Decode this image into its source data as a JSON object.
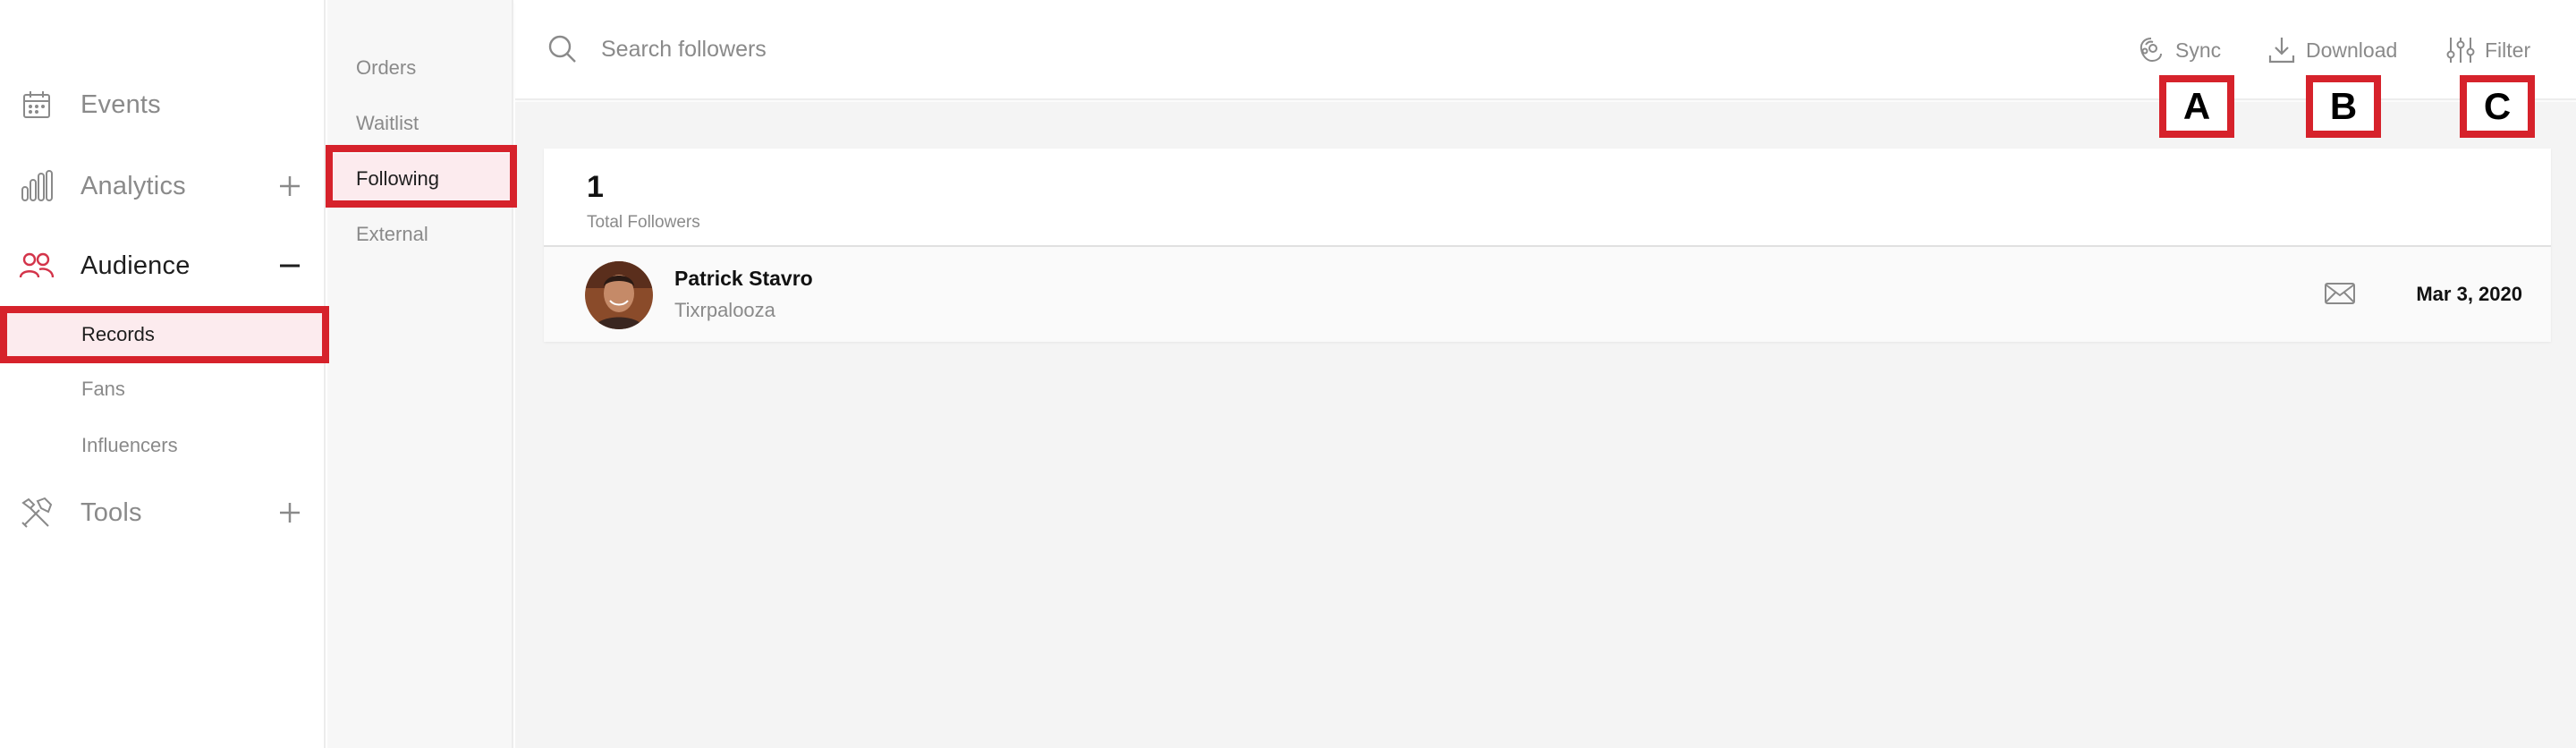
{
  "sidebar": {
    "items": [
      {
        "label": "Events",
        "icon": "calendar-icon",
        "toggle": ""
      },
      {
        "label": "Analytics",
        "icon": "bar-chart-icon",
        "toggle": "plus-icon"
      },
      {
        "label": "Audience",
        "icon": "users-icon",
        "toggle": "minus-icon",
        "active": true,
        "children": [
          {
            "label": "Records",
            "active": true
          },
          {
            "label": "Fans"
          },
          {
            "label": "Influencers"
          }
        ]
      },
      {
        "label": "Tools",
        "icon": "tools-icon",
        "toggle": "plus-icon"
      }
    ]
  },
  "subnav": {
    "items": [
      {
        "label": "Orders"
      },
      {
        "label": "Waitlist"
      },
      {
        "label": "Following",
        "active": true
      },
      {
        "label": "External"
      }
    ]
  },
  "search": {
    "placeholder": "Search followers",
    "value": ""
  },
  "toolbar": {
    "sync_label": "Sync",
    "download_label": "Download",
    "filter_label": "Filter"
  },
  "markers": {
    "a": "A",
    "b": "B",
    "c": "C"
  },
  "summary": {
    "count": "1",
    "label": "Total Followers"
  },
  "followers": [
    {
      "name": "Patrick Stavro",
      "event": "Tixrpalooza",
      "date": "Mar 3, 2020"
    }
  ],
  "colors": {
    "accent": "#d6222b",
    "audience_icon": "#d3344a",
    "active_bg": "#fcebee",
    "muted_text": "#8a8a8a",
    "main_bg": "#f4f4f4"
  }
}
